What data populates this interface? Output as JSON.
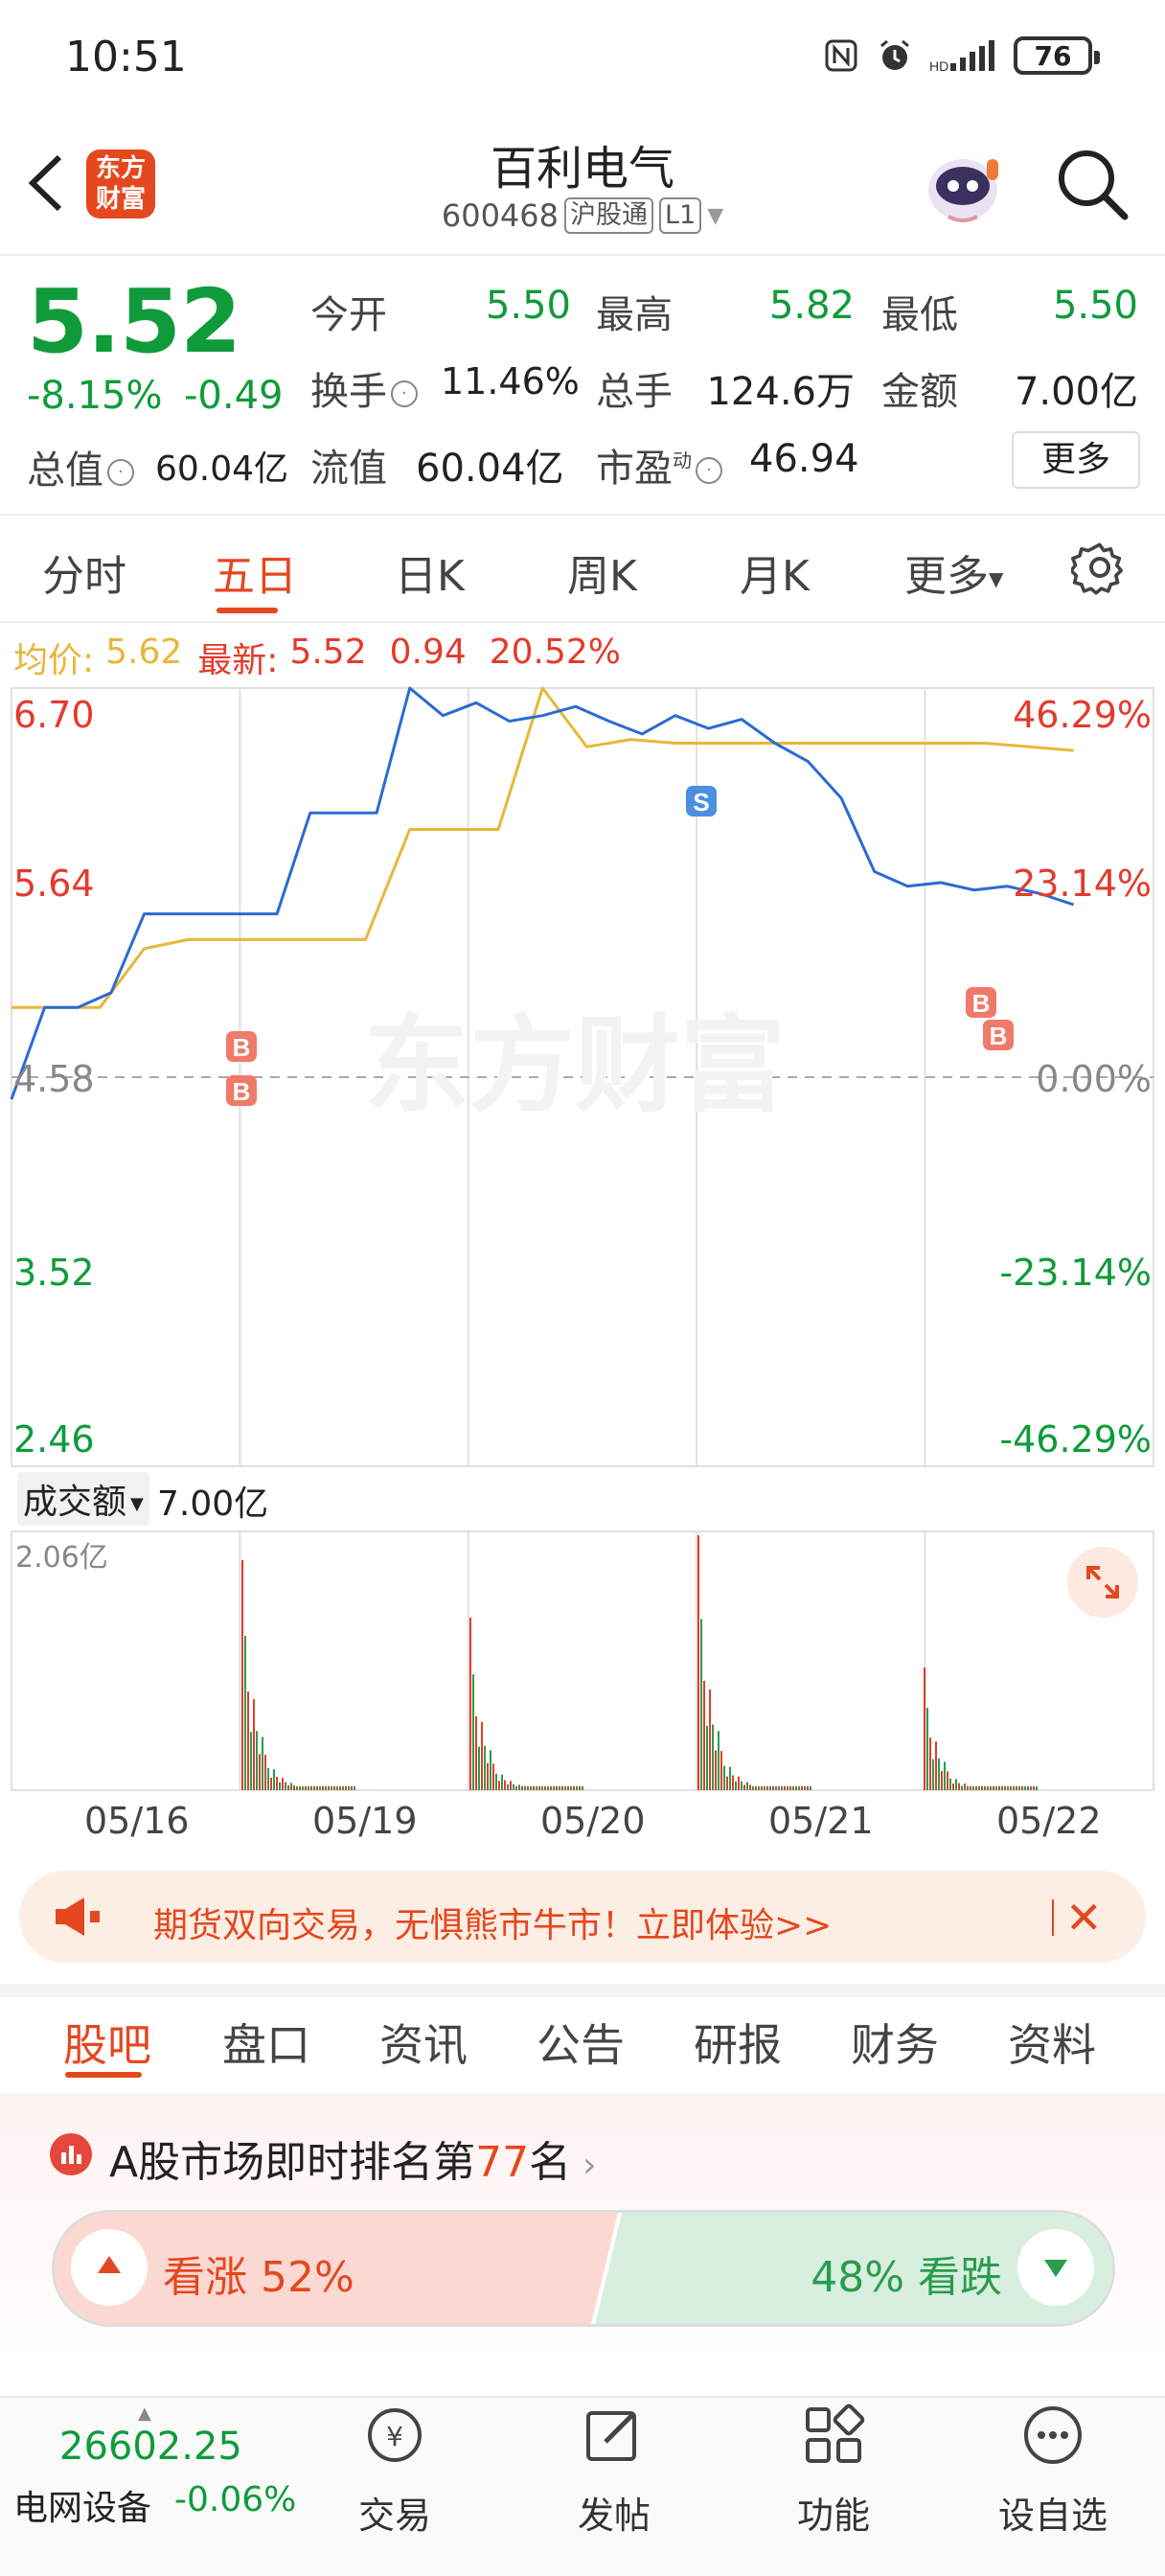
{
  "status_bar": {
    "time": "10:51",
    "battery": "76"
  },
  "header": {
    "logo_line1": "东方",
    "logo_line2": "财富",
    "stock_name": "百利电气",
    "stock_code": "600468",
    "tag_connect": "沪股通",
    "tag_level": "L1"
  },
  "quote": {
    "price": "5.52",
    "change_pct": "-8.15%",
    "change_amt": "-0.49",
    "open_label": "今开",
    "open": "5.50",
    "high_label": "最高",
    "high": "5.82",
    "low_label": "最低",
    "low": "5.50",
    "turnover_label": "换手",
    "turnover": "11.46%",
    "volume_label": "总手",
    "volume": "124.6万",
    "amount_label": "金额",
    "amount": "7.00亿",
    "mcap_label": "总值",
    "mcap": "60.04亿",
    "float_label": "流值",
    "float_cap": "60.04亿",
    "pe_label": "市盈",
    "pe_sup": "动",
    "pe": "46.94",
    "more_label": "更多"
  },
  "chart_tabs": [
    "分时",
    "五日",
    "日K",
    "周K",
    "月K",
    "更多"
  ],
  "info_line": {
    "avg_label": "均价:",
    "avg": "5.62",
    "latest_label": "最新:",
    "latest": "5.52",
    "change": "0.94",
    "change_pct": "20.52%"
  },
  "chart_data": {
    "type": "line",
    "title": "",
    "x_days": [
      "05/16",
      "05/19",
      "05/20",
      "05/21",
      "05/22"
    ],
    "y_ticks_left": [
      "6.70",
      "5.64",
      "4.58",
      "3.52",
      "2.46"
    ],
    "y_ticks_right": [
      "46.29%",
      "23.14%",
      "0.00%",
      "-23.14%",
      "-46.29%"
    ],
    "ylim": [
      2.46,
      6.7
    ],
    "baseline": 4.58,
    "series": [
      {
        "values": [
          4.46,
          4.96,
          4.96,
          5.04,
          5.47,
          5.47,
          5.47,
          5.47,
          5.47,
          6.02,
          6.02,
          6.02,
          6.7,
          6.55,
          6.62,
          6.52,
          6.55,
          6.6,
          6.52,
          6.45,
          6.55,
          6.48,
          6.53,
          6.4,
          6.3,
          6.1,
          5.7,
          5.62,
          5.64,
          5.6,
          5.62,
          5.58,
          5.52
        ]
      },
      {
        "values": [
          4.96,
          4.96,
          4.96,
          5.28,
          5.33,
          5.33,
          5.33,
          5.33,
          5.33,
          5.93,
          5.93,
          5.93,
          6.7,
          6.38,
          6.42,
          6.4,
          6.4,
          6.4,
          6.4,
          6.4,
          6.4,
          6.4,
          6.4,
          6.38,
          6.36
        ]
      }
    ],
    "markers": [
      "B",
      "B",
      "S",
      "B",
      "B"
    ],
    "volume_label": "成交额",
    "volume_value": "7.00亿",
    "volume_max": "2.06亿",
    "watermark": "东方财富"
  },
  "banner": {
    "text": "期货双向交易，无惧熊市牛市！立即体验>>"
  },
  "bottom_tabs": [
    "股吧",
    "盘口",
    "资讯",
    "公告",
    "研报",
    "财务",
    "资料"
  ],
  "ranking": {
    "prefix": "A股市场即时排名第",
    "rank": "77",
    "suffix": "名"
  },
  "vote": {
    "bull_label": "看涨 52%",
    "bear_label": "48% 看跌",
    "bull_pct": 52
  },
  "bottom_nav": {
    "index_value": "26602.25",
    "index_name": "电网设备",
    "index_change": "-0.06%",
    "items": [
      "交易",
      "发帖",
      "功能",
      "设自选"
    ]
  },
  "colors": {
    "up": "#e33b2c",
    "down": "#0f9b3a",
    "accent": "#e5471e",
    "price_line": "#2b6bd1",
    "avg_line": "#e8b73a"
  }
}
